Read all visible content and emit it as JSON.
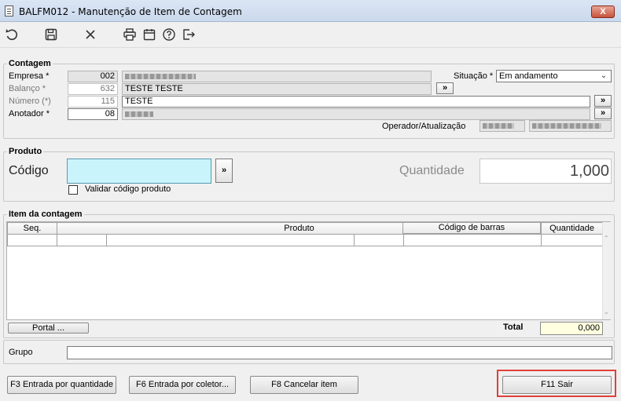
{
  "window": {
    "title": "BALFM012 - Manutenção de Item de Contagem",
    "close_label": "X"
  },
  "toolbar": {
    "icons": [
      "undo-icon",
      "save-icon",
      "cancel-icon",
      "print-icon",
      "calendar-icon",
      "help-icon",
      "exit-icon"
    ]
  },
  "contagem": {
    "title": "Contagem",
    "empresa_label": "Empresa *",
    "empresa_code": "002",
    "balanco_label": "Balanço *",
    "balanco_code": "632",
    "balanco_desc": "TESTE TESTE",
    "numero_label": "Número (*)",
    "numero_code": "115",
    "numero_desc": "TESTE",
    "anotador_label": "Anotador *",
    "anotador_code": "08",
    "situacao_label": "Situação *",
    "situacao_value": "Em andamento",
    "operador_label": "Operador/Atualização",
    "lookup_label": "»"
  },
  "produto": {
    "title": "Produto",
    "codigo_label": "Código",
    "codigo_value": "",
    "lookup_label": "»",
    "validar_label": "Validar código produto",
    "validar_checked": false,
    "quantidade_label": "Quantidade",
    "quantidade_value": "1,000"
  },
  "item": {
    "title": "Item da contagem",
    "columns": [
      "Seq.",
      "Produto",
      "Código de barras",
      "Quantidade"
    ],
    "portal_label": "Portal ...",
    "total_label": "Total",
    "total_value": "0,000"
  },
  "grupo": {
    "label": "Grupo",
    "value": ""
  },
  "footer": {
    "f3_label": "F3 Entrada por quantidade",
    "f6_label": "F6 Entrada por coletor...",
    "f8_label": "F8 Cancelar item",
    "f11_label": "F11 Sair"
  },
  "colors": {
    "codigo_bg": "#c9f4fb",
    "total_bg": "#ffffe0",
    "highlight": "#e0403a"
  }
}
